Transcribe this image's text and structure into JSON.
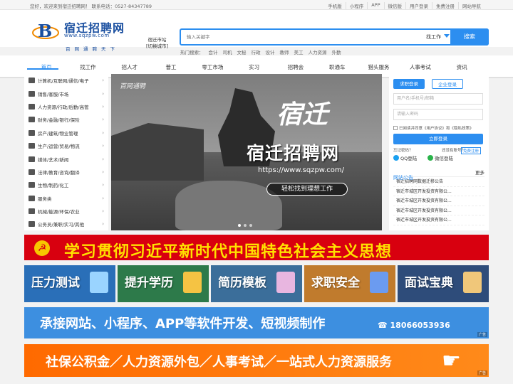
{
  "topbar": {
    "welcome": "您好，欢迎来到宿迁招聘网！ 联系电话：0527-84347789",
    "links": [
      "手机版",
      "小程序",
      "APP",
      "微信版",
      "用户登录",
      "免费注册",
      "网站导航"
    ]
  },
  "logo": {
    "title": "宿迁招聘网",
    "url": "www.sqzpw.com",
    "tagline": "百网通聘天下"
  },
  "city": {
    "name": "宿迁市站",
    "switch": "[切换城市]"
  },
  "search": {
    "placeholder": "输入关键字",
    "type_label": "找工作",
    "button": "搜索"
  },
  "hot": {
    "label": "热门搜索：",
    "terms": [
      "会计",
      "司机",
      "文秘",
      "行政",
      "设计",
      "教师",
      "美工",
      "人力资源",
      "外勤"
    ]
  },
  "nav": [
    "首页",
    "找工作",
    "招人才",
    "普工",
    "零工市场",
    "实习",
    "招聘会",
    "职通车",
    "猎头服务",
    "人事考试",
    "资讯"
  ],
  "categories": [
    "计算机/互联网/通信/电子",
    "销售/客服/市场",
    "人力资源/行政/后勤/高管",
    "财务/金融/银行/保险",
    "房产/建筑/物业管理",
    "生产/运营/贸易/物流",
    "媒体/艺术/新闻",
    "法律/教育/咨询/翻译",
    "生物/制药/化工",
    "服务类",
    "机械/能源/环保/农业",
    "公务员/兼职/实习/其他"
  ],
  "banner": {
    "stamp": "百网通聘",
    "calligraphy": "宿迁",
    "title": "宿迁招聘网",
    "url": "https://www.sqzpw.com/",
    "slogan": "轻松找到理想工作"
  },
  "login": {
    "tab_job_seeker": "求职登录",
    "tab_company": "企业登录",
    "user_placeholder": "用户名/手机号/邮箱",
    "password_placeholder": "请输入密码",
    "agree": "已阅读并同意《用户协议》和《隐私政策》",
    "button": "立即登录",
    "forgot": "忘记密码？",
    "no_account": "还没有账号？",
    "register": "免费注册",
    "qq": "QQ登陆",
    "wechat": "微信登陆"
  },
  "notice": {
    "title": "网站公告",
    "more": "更多",
    "items": [
      "宿迁招聘网数据迁移公告",
      "宿迁市城区开发投资有限公...",
      "宿迁市城区开发投资有限公...",
      "宿迁市城区开发投资有限公...",
      "宿迁市城区开发投资有限公..."
    ]
  },
  "ad_banner_1": "学习贯彻习近平新时代中国特色社会主义思想",
  "tiles": [
    {
      "label": "压力测试",
      "color": "#2a6fb8",
      "icon_color": "#9ad4ff"
    },
    {
      "label": "提升学历",
      "color": "#2d7a4a",
      "icon_color": "#f5c343"
    },
    {
      "label": "简历模板",
      "color": "#3b6e9a",
      "icon_color": "#e8b6e0"
    },
    {
      "label": "求职安全",
      "color": "#c07b2d",
      "icon_color": "#6b9bf0"
    },
    {
      "label": "面试宝典",
      "color": "#2e4c7a",
      "icon_color": "#f0c77a"
    }
  ],
  "ad_banner_2": {
    "text": "承接网站、小程序、APP等软件开发、短视频制作",
    "phone": "18066053936",
    "tag": "广告"
  },
  "ad_banner_3": {
    "text": "社保公积金／人力资源外包／人事考试／一站式人力资源服务",
    "tag": "广告"
  },
  "colors": {
    "brand": "#2c8ef0",
    "red_banner": "#d8000f",
    "orange_banner": "#ff6a00"
  }
}
